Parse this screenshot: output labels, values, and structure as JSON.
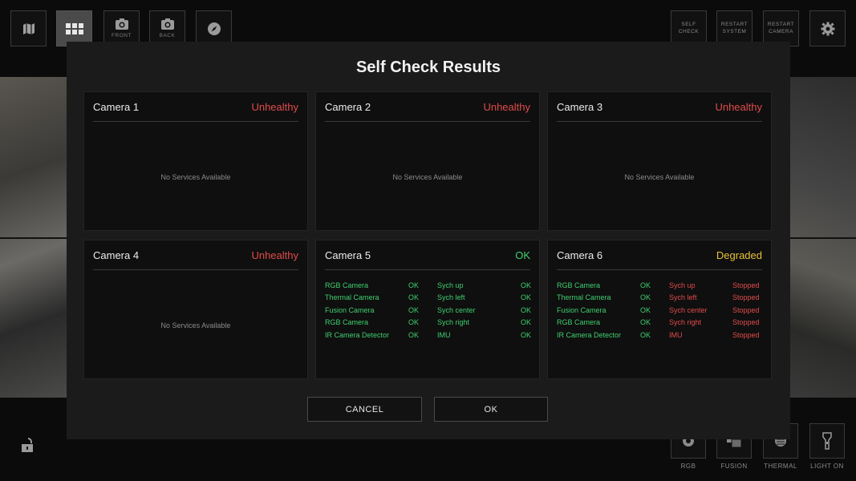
{
  "toolbar": {
    "front_label": "FRONT",
    "back_label": "BACK",
    "self_check": [
      "SELF",
      "CHECK"
    ],
    "restart_system": [
      "RESTART",
      "SYSTEM"
    ],
    "restart_camera": [
      "RESTART",
      "CAMERA"
    ]
  },
  "bottom": {
    "rgb_label": "RGB",
    "fusion_label": "FUSION",
    "thermal_label": "THERMAL",
    "light_label": "LIGHT ON"
  },
  "modal": {
    "title": "Self Check Results",
    "cancel_label": "CANCEL",
    "ok_label": "OK",
    "cameras": [
      {
        "name": "Camera 1",
        "status": "Unhealthy",
        "empty_text": "No Services Available"
      },
      {
        "name": "Camera 2",
        "status": "Unhealthy",
        "empty_text": "No Services Available"
      },
      {
        "name": "Camera 3",
        "status": "Unhealthy",
        "empty_text": "No Services Available"
      },
      {
        "name": "Camera 4",
        "status": "Unhealthy",
        "empty_text": "No Services Available"
      },
      {
        "name": "Camera 5",
        "status": "OK",
        "services_left": [
          {
            "name": "RGB Camera",
            "value": "OK"
          },
          {
            "name": "Thermal Camera",
            "value": "OK"
          },
          {
            "name": "Fusion Camera",
            "value": "OK"
          },
          {
            "name": "RGB Camera",
            "value": "OK"
          },
          {
            "name": "IR Camera Detector",
            "value": "OK"
          }
        ],
        "services_right": [
          {
            "name": "Sych up",
            "value": "OK"
          },
          {
            "name": "Sych left",
            "value": "OK"
          },
          {
            "name": "Sych center",
            "value": "OK"
          },
          {
            "name": "Sych right",
            "value": "OK"
          },
          {
            "name": "IMU",
            "value": "OK"
          }
        ]
      },
      {
        "name": "Camera 6",
        "status": "Degraded",
        "services_left": [
          {
            "name": "RGB Camera",
            "value": "OK"
          },
          {
            "name": "Thermal Camera",
            "value": "OK"
          },
          {
            "name": "Fusion Camera",
            "value": "OK"
          },
          {
            "name": "RGB Camera",
            "value": "OK"
          },
          {
            "name": "IR Camera Detector",
            "value": "OK"
          }
        ],
        "services_right": [
          {
            "name": "Sych up",
            "value": "Stopped"
          },
          {
            "name": "Sych left",
            "value": "Stopped"
          },
          {
            "name": "Sych center",
            "value": "Stopped"
          },
          {
            "name": "Sych right",
            "value": "Stopped"
          },
          {
            "name": "IMU",
            "value": "Stopped"
          }
        ]
      }
    ]
  },
  "colors": {
    "unhealthy": "#e14b4b",
    "ok": "#3fcf6f",
    "degraded": "#e8c23a"
  }
}
